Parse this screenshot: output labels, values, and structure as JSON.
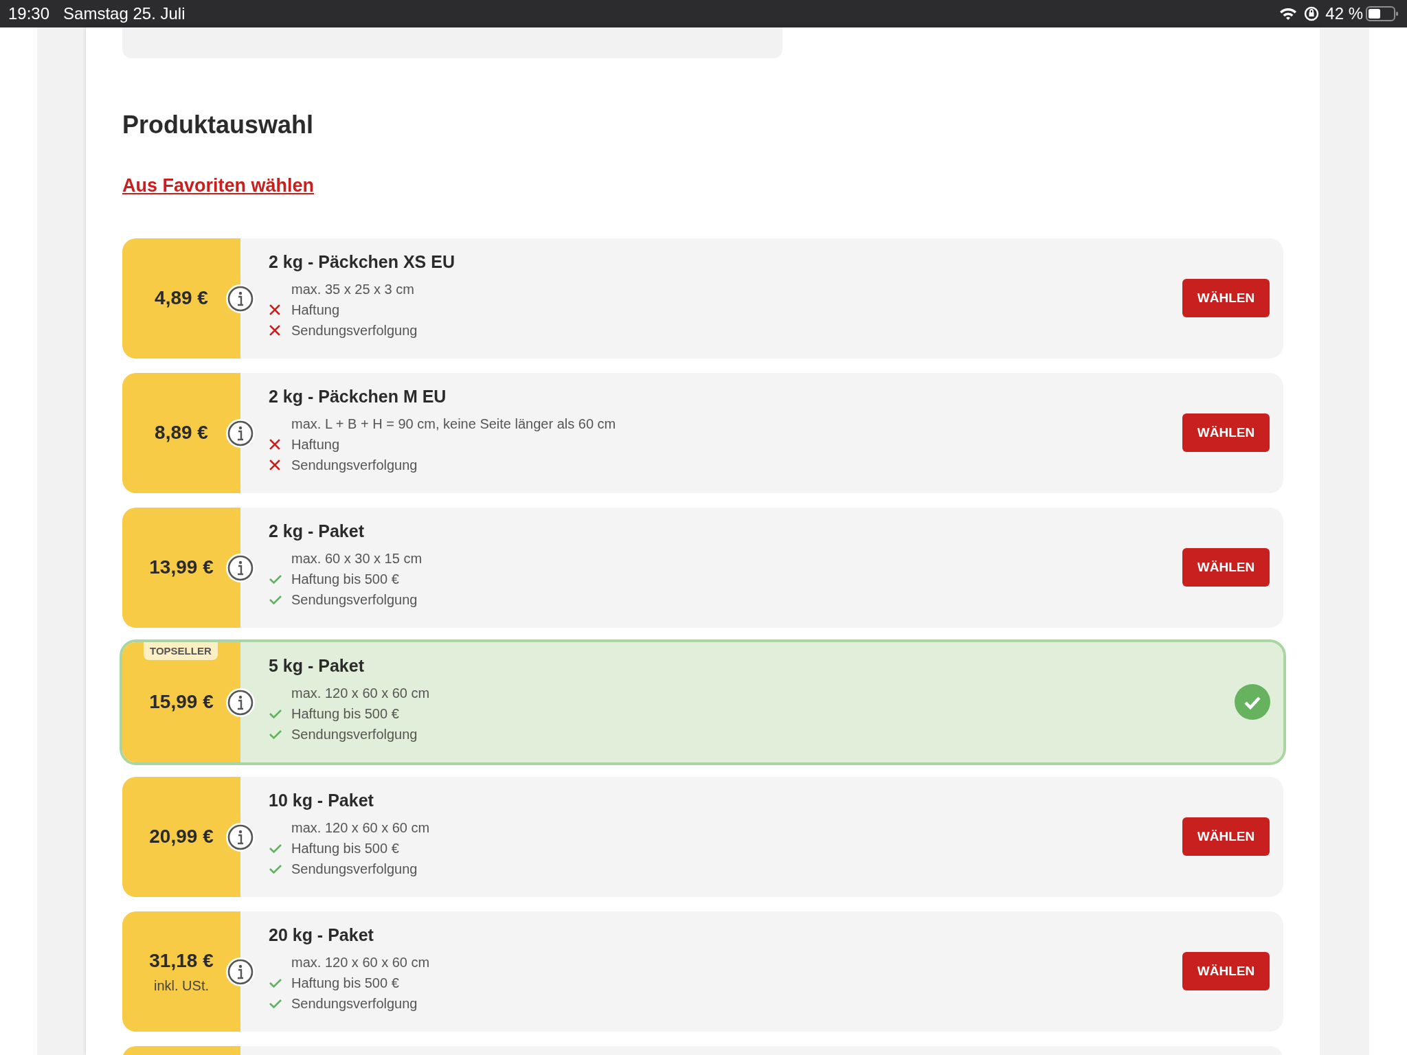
{
  "status_bar": {
    "time": "19:30",
    "date": "Samstag 25. Juli",
    "battery": "42 %"
  },
  "heading": "Produktauswahl",
  "favorites_link": "Aus Favoriten wählen",
  "products": [
    {
      "price": "4,89 €",
      "title": "2 kg - Päckchen XS EU",
      "size": "max. 35 x 25 x 3 cm",
      "features": [
        {
          "kind": "excluded",
          "text": "Haftung"
        },
        {
          "kind": "excluded",
          "text": "Sendungsverfolgung"
        }
      ],
      "selected": false,
      "button": "WÄHLEN"
    },
    {
      "price": "8,89 €",
      "title": "2 kg - Päckchen M EU",
      "size": "max. L + B + H = 90 cm, keine Seite länger als 60 cm",
      "features": [
        {
          "kind": "excluded",
          "text": "Haftung"
        },
        {
          "kind": "excluded",
          "text": "Sendungsverfolgung"
        }
      ],
      "selected": false,
      "button": "WÄHLEN"
    },
    {
      "price": "13,99 €",
      "title": "2 kg - Paket",
      "size": "max. 60 x 30 x 15 cm",
      "features": [
        {
          "kind": "included",
          "text": "Haftung bis 500 €"
        },
        {
          "kind": "included",
          "text": "Sendungsverfolgung"
        }
      ],
      "selected": false,
      "button": "WÄHLEN"
    },
    {
      "badge": "TOPSELLER",
      "price": "15,99 €",
      "title": "5 kg - Paket",
      "size": "max. 120 x 60 x 60 cm",
      "features": [
        {
          "kind": "included",
          "text": "Haftung bis 500 €"
        },
        {
          "kind": "included",
          "text": "Sendungsverfolgung"
        }
      ],
      "selected": true
    },
    {
      "price": "20,99 €",
      "title": "10 kg - Paket",
      "size": "max. 120 x 60 x 60 cm",
      "features": [
        {
          "kind": "included",
          "text": "Haftung bis 500 €"
        },
        {
          "kind": "included",
          "text": "Sendungsverfolgung"
        }
      ],
      "selected": false,
      "button": "WÄHLEN"
    },
    {
      "price": "31,18 €",
      "price_note": "inkl. USt.",
      "title": "20 kg - Paket",
      "size": "max. 120 x 60 x 60 cm",
      "features": [
        {
          "kind": "included",
          "text": "Haftung bis 500 €"
        },
        {
          "kind": "included",
          "text": "Sendungsverfolgung"
        }
      ],
      "selected": false,
      "button": "WÄHLEN"
    }
  ]
}
